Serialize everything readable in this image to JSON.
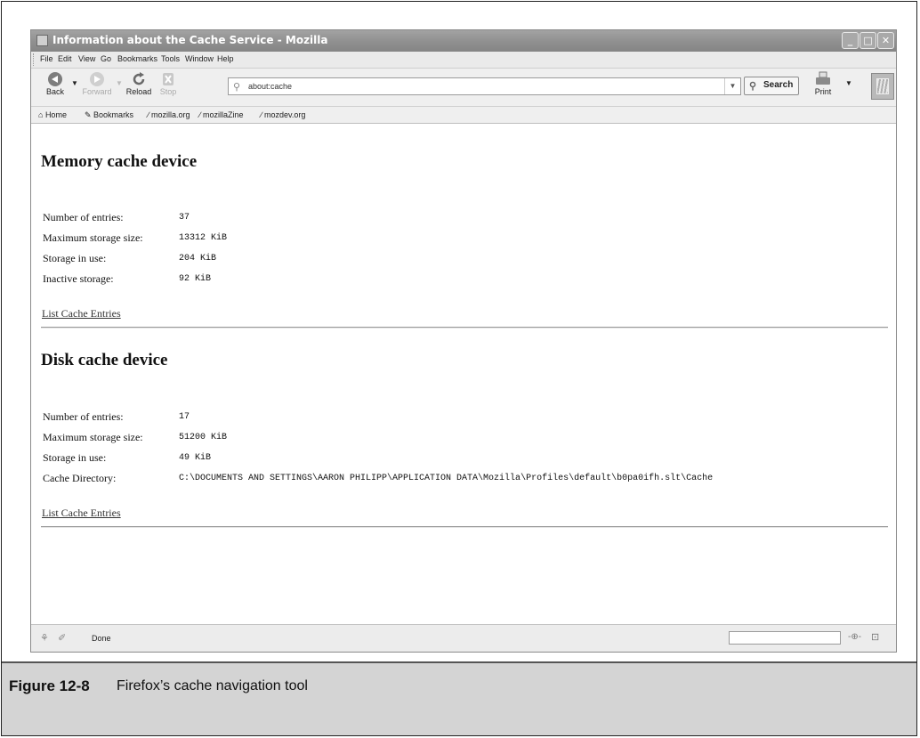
{
  "window": {
    "title": "Information about the Cache Service - Mozilla"
  },
  "menu": [
    "File",
    "Edit",
    "View",
    "Go",
    "Bookmarks",
    "Tools",
    "Window",
    "Help"
  ],
  "toolbar": {
    "back_label": "Back",
    "forward_label": "Forward",
    "reload_label": "Reload",
    "stop_label": "Stop",
    "url": "about:cache",
    "search_label": "Search",
    "print_label": "Print"
  },
  "bookmarks": [
    "Home",
    "Bookmarks",
    "mozilla.org",
    "mozillaZine",
    "mozdev.org"
  ],
  "memory": {
    "heading": "Memory cache device",
    "rows": [
      {
        "label": "Number of entries:",
        "value": "37"
      },
      {
        "label": "Maximum storage size:",
        "value": "13312 KiB"
      },
      {
        "label": "Storage in use:",
        "value": "204 KiB"
      },
      {
        "label": "Inactive storage:",
        "value": "92 KiB"
      }
    ],
    "link": "List Cache Entries"
  },
  "disk": {
    "heading": "Disk cache device",
    "rows": [
      {
        "label": "Number of entries:",
        "value": "17"
      },
      {
        "label": "Maximum storage size:",
        "value": "51200 KiB"
      },
      {
        "label": "Storage in use:",
        "value": "49 KiB"
      },
      {
        "label": "Cache Directory:",
        "value": "C:\\DOCUMENTS AND SETTINGS\\AARON PHILIPP\\APPLICATION DATA\\Mozilla\\Profiles\\default\\b0pa0ifh.slt\\Cache"
      }
    ],
    "link": "List Cache Entries"
  },
  "status": {
    "text": "Done"
  },
  "caption": {
    "number": "Figure 12-8",
    "text": "Firefox’s cache navigation tool"
  }
}
